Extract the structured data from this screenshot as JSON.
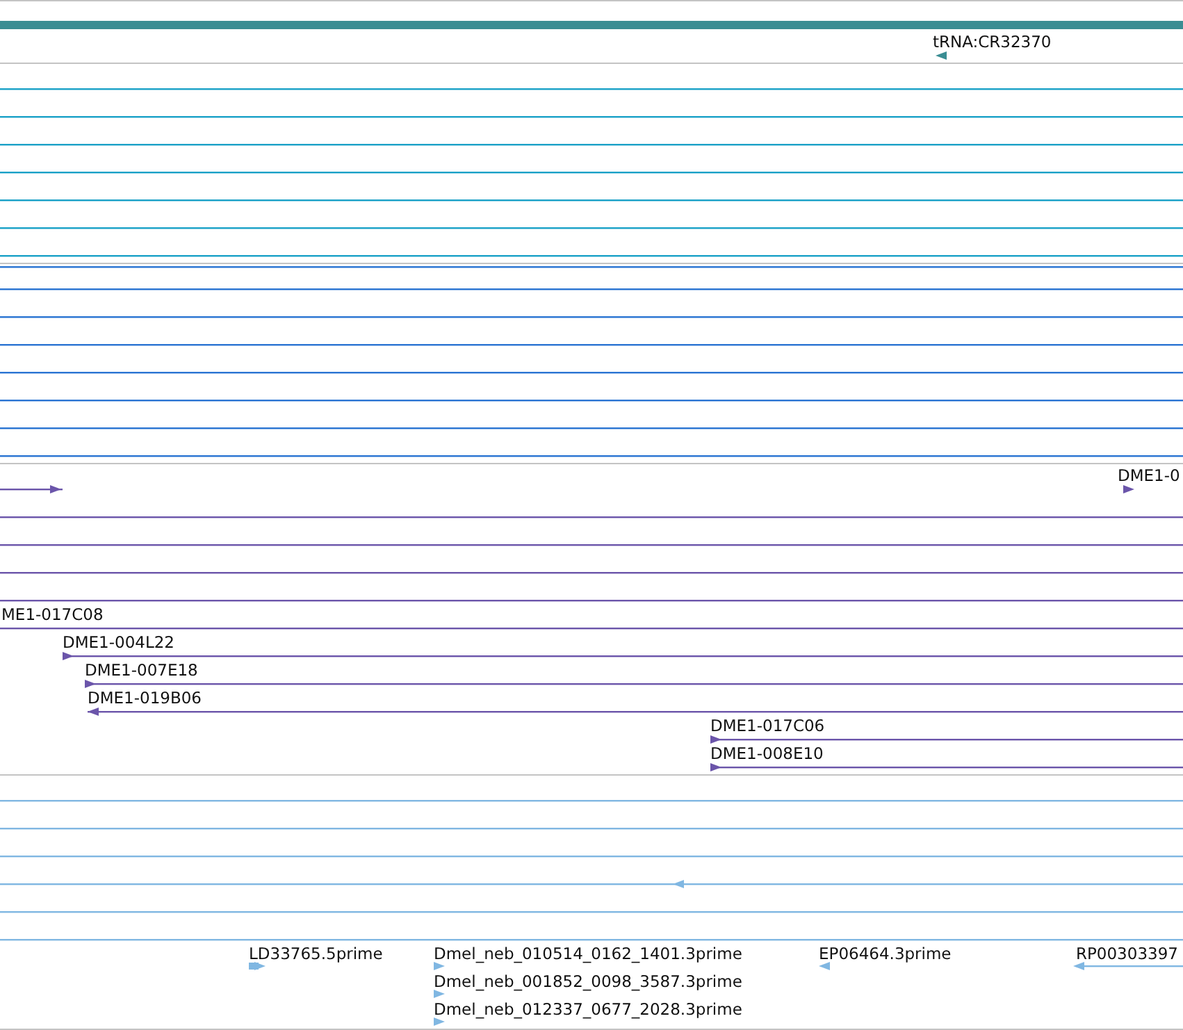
{
  "tracks": [
    {
      "color": "#3a8d93",
      "features": [
        {
          "kind": "bar"
        },
        {
          "kind": "reverse",
          "label": "tRNA:CR32370"
        }
      ]
    },
    {
      "color": "#1aa1c7",
      "features": [
        {
          "kind": "span"
        },
        {
          "kind": "span"
        },
        {
          "kind": "span"
        },
        {
          "kind": "span"
        },
        {
          "kind": "span"
        },
        {
          "kind": "span"
        },
        {
          "kind": "span"
        }
      ]
    },
    {
      "color": "#2a74d2",
      "features": [
        {
          "kind": "span"
        },
        {
          "kind": "span"
        },
        {
          "kind": "span"
        },
        {
          "kind": "span"
        },
        {
          "kind": "span"
        },
        {
          "kind": "span"
        },
        {
          "kind": "span"
        },
        {
          "kind": "span"
        }
      ]
    },
    {
      "color": "#6b55aa",
      "features": [
        {
          "kind": "forward"
        },
        {
          "kind": "forward",
          "label": "DME1-0"
        },
        {
          "kind": "span"
        },
        {
          "kind": "span"
        },
        {
          "kind": "span"
        },
        {
          "kind": "span"
        },
        {
          "kind": "span",
          "label": "ME1-017C08"
        },
        {
          "kind": "forward",
          "label": "DME1-004L22"
        },
        {
          "kind": "forward",
          "label": "DME1-007E18"
        },
        {
          "kind": "reverse",
          "label": "DME1-019B06"
        },
        {
          "kind": "forward",
          "label": "DME1-017C06"
        },
        {
          "kind": "forward",
          "label": "DME1-008E10"
        }
      ]
    },
    {
      "color": "#80b7e2",
      "features": [
        {
          "kind": "span"
        },
        {
          "kind": "span"
        },
        {
          "kind": "span"
        },
        {
          "kind": "reverse"
        },
        {
          "kind": "span"
        },
        {
          "kind": "span"
        },
        {
          "kind": "forward",
          "label": "LD33765.5prime"
        },
        {
          "kind": "forward",
          "label": "Dmel_neb_010514_0162_1401.3prime"
        },
        {
          "kind": "reverse",
          "label": "EP06464.3prime"
        },
        {
          "kind": "reverse",
          "label": "RP00303397"
        },
        {
          "kind": "forward",
          "label": "Dmel_neb_001852_0098_3587.3prime"
        },
        {
          "kind": "forward",
          "label": "Dmel_neb_012337_0677_2028.3prime"
        }
      ]
    }
  ]
}
